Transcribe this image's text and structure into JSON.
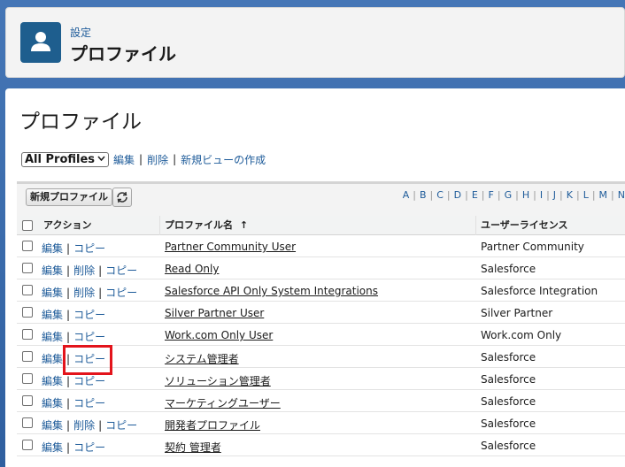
{
  "header": {
    "breadcrumb": "設定",
    "title": "プロファイル",
    "icon": "user-icon"
  },
  "page": {
    "title": "プロファイル"
  },
  "view": {
    "selected": "All Profiles",
    "edit": "編集",
    "delete": "削除",
    "new_view": "新規ビューの作成"
  },
  "toolbar": {
    "new_profile": "新規プロファイル",
    "refresh_icon": "refresh-icon"
  },
  "alphabet": [
    "A",
    "B",
    "C",
    "D",
    "E",
    "F",
    "G",
    "H",
    "I",
    "J",
    "K",
    "L",
    "M",
    "N"
  ],
  "table": {
    "headers": {
      "action": "アクション",
      "name": "プロファイル名",
      "sort": "↑",
      "license": "ユーザーライセンス"
    },
    "rows": [
      {
        "edit": "編集",
        "delete": "",
        "copy": "コピー",
        "name": "Partner Community User",
        "license": "Partner Community"
      },
      {
        "edit": "編集",
        "delete": "削除",
        "copy": "コピー",
        "name": "Read Only",
        "license": "Salesforce"
      },
      {
        "edit": "編集",
        "delete": "削除",
        "copy": "コピー",
        "name": "Salesforce API Only System Integrations",
        "license": "Salesforce Integration"
      },
      {
        "edit": "編集",
        "delete": "",
        "copy": "コピー",
        "name": "Silver Partner User",
        "license": "Silver Partner"
      },
      {
        "edit": "編集",
        "delete": "",
        "copy": "コピー",
        "name": "Work.com Only User",
        "license": "Work.com Only"
      },
      {
        "edit": "編集",
        "delete": "",
        "copy": "コピー",
        "name": "システム管理者",
        "license": "Salesforce"
      },
      {
        "edit": "編集",
        "delete": "",
        "copy": "コピー",
        "name": "ソリューション管理者",
        "license": "Salesforce"
      },
      {
        "edit": "編集",
        "delete": "",
        "copy": "コピー",
        "name": "マーケティングユーザー",
        "license": "Salesforce"
      },
      {
        "edit": "編集",
        "delete": "削除",
        "copy": "コピー",
        "name": "開発者プロファイル",
        "license": "Salesforce"
      },
      {
        "edit": "編集",
        "delete": "",
        "copy": "コピー",
        "name": "契約 管理者",
        "license": "Salesforce"
      }
    ]
  },
  "colors": {
    "link": "#1f5c9a",
    "highlight": "#e3141b",
    "header_icon_bg": "#1e5e8e"
  }
}
